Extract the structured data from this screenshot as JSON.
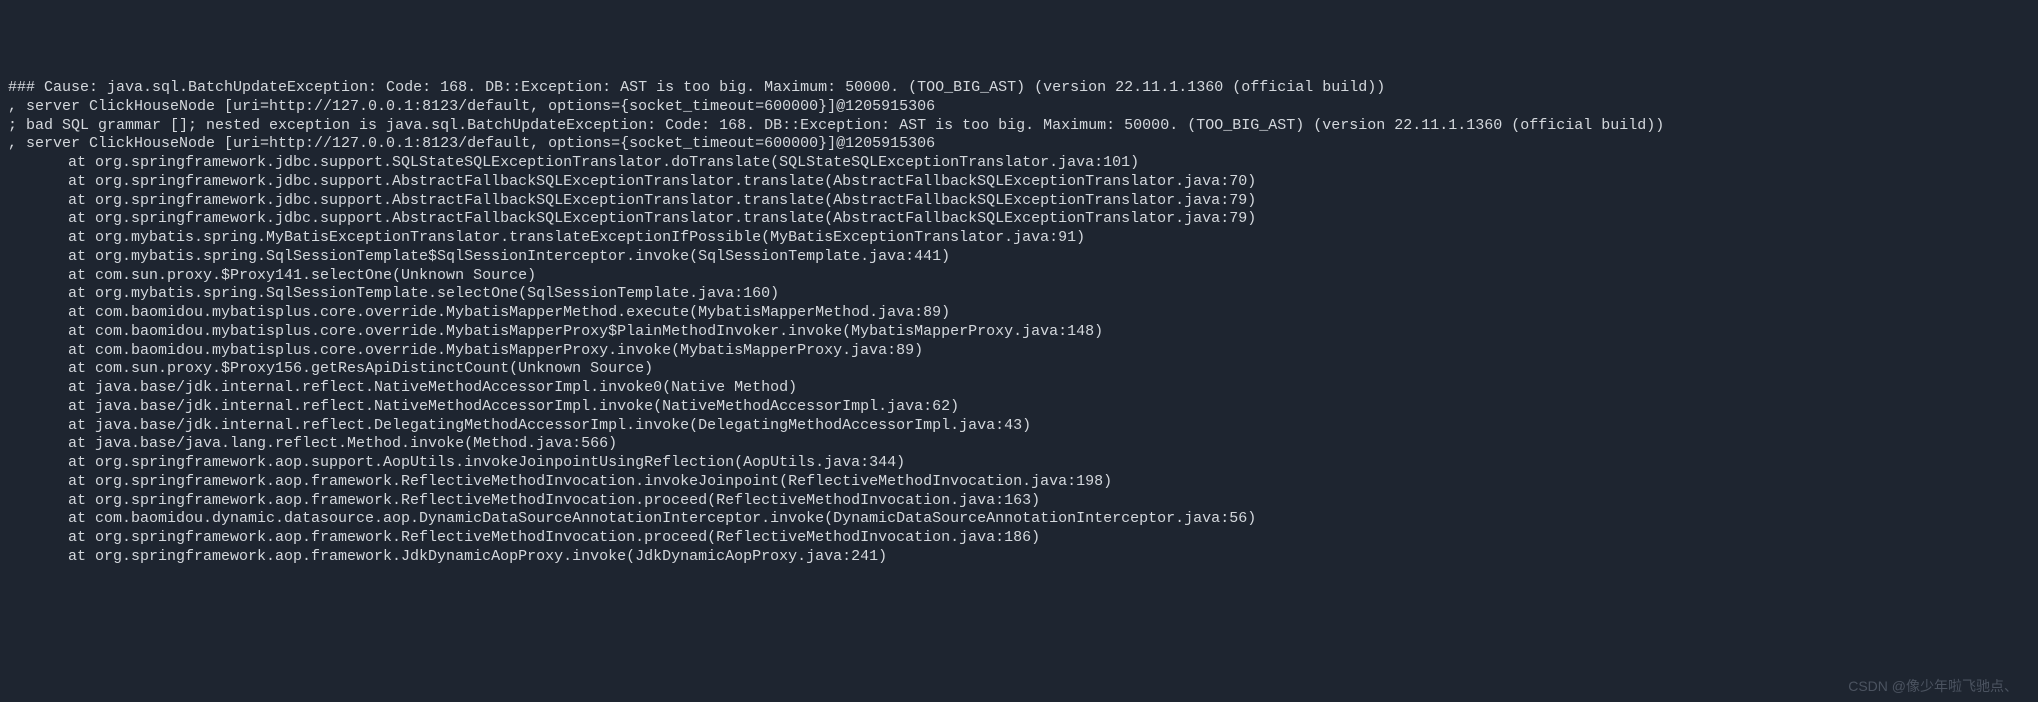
{
  "header_lines": [
    "### Cause: java.sql.BatchUpdateException: Code: 168. DB::Exception: AST is too big. Maximum: 50000. (TOO_BIG_AST) (version 22.11.1.1360 (official build))",
    ", server ClickHouseNode [uri=http://127.0.0.1:8123/default, options={socket_timeout=600000}]@1205915306",
    "; bad SQL grammar []; nested exception is java.sql.BatchUpdateException: Code: 168. DB::Exception: AST is too big. Maximum: 50000. (TOO_BIG_AST) (version 22.11.1.1360 (official build))",
    ", server ClickHouseNode [uri=http://127.0.0.1:8123/default, options={socket_timeout=600000}]@1205915306"
  ],
  "stack_trace": [
    "at org.springframework.jdbc.support.SQLStateSQLExceptionTranslator.doTranslate(SQLStateSQLExceptionTranslator.java:101)",
    "at org.springframework.jdbc.support.AbstractFallbackSQLExceptionTranslator.translate(AbstractFallbackSQLExceptionTranslator.java:70)",
    "at org.springframework.jdbc.support.AbstractFallbackSQLExceptionTranslator.translate(AbstractFallbackSQLExceptionTranslator.java:79)",
    "at org.springframework.jdbc.support.AbstractFallbackSQLExceptionTranslator.translate(AbstractFallbackSQLExceptionTranslator.java:79)",
    "at org.mybatis.spring.MyBatisExceptionTranslator.translateExceptionIfPossible(MyBatisExceptionTranslator.java:91)",
    "at org.mybatis.spring.SqlSessionTemplate$SqlSessionInterceptor.invoke(SqlSessionTemplate.java:441)",
    "at com.sun.proxy.$Proxy141.selectOne(Unknown Source)",
    "at org.mybatis.spring.SqlSessionTemplate.selectOne(SqlSessionTemplate.java:160)",
    "at com.baomidou.mybatisplus.core.override.MybatisMapperMethod.execute(MybatisMapperMethod.java:89)",
    "at com.baomidou.mybatisplus.core.override.MybatisMapperProxy$PlainMethodInvoker.invoke(MybatisMapperProxy.java:148)",
    "at com.baomidou.mybatisplus.core.override.MybatisMapperProxy.invoke(MybatisMapperProxy.java:89)",
    "at com.sun.proxy.$Proxy156.getResApiDistinctCount(Unknown Source)",
    "at java.base/jdk.internal.reflect.NativeMethodAccessorImpl.invoke0(Native Method)",
    "at java.base/jdk.internal.reflect.NativeMethodAccessorImpl.invoke(NativeMethodAccessorImpl.java:62)",
    "at java.base/jdk.internal.reflect.DelegatingMethodAccessorImpl.invoke(DelegatingMethodAccessorImpl.java:43)",
    "at java.base/java.lang.reflect.Method.invoke(Method.java:566)",
    "at org.springframework.aop.support.AopUtils.invokeJoinpointUsingReflection(AopUtils.java:344)",
    "at org.springframework.aop.framework.ReflectiveMethodInvocation.invokeJoinpoint(ReflectiveMethodInvocation.java:198)",
    "at org.springframework.aop.framework.ReflectiveMethodInvocation.proceed(ReflectiveMethodInvocation.java:163)",
    "at com.baomidou.dynamic.datasource.aop.DynamicDataSourceAnnotationInterceptor.invoke(DynamicDataSourceAnnotationInterceptor.java:56)",
    "at org.springframework.aop.framework.ReflectiveMethodInvocation.proceed(ReflectiveMethodInvocation.java:186)",
    "at org.springframework.aop.framework.JdkDynamicAopProxy.invoke(JdkDynamicAopProxy.java:241)"
  ],
  "watermark": "CSDN @像少年啦飞驰点、"
}
